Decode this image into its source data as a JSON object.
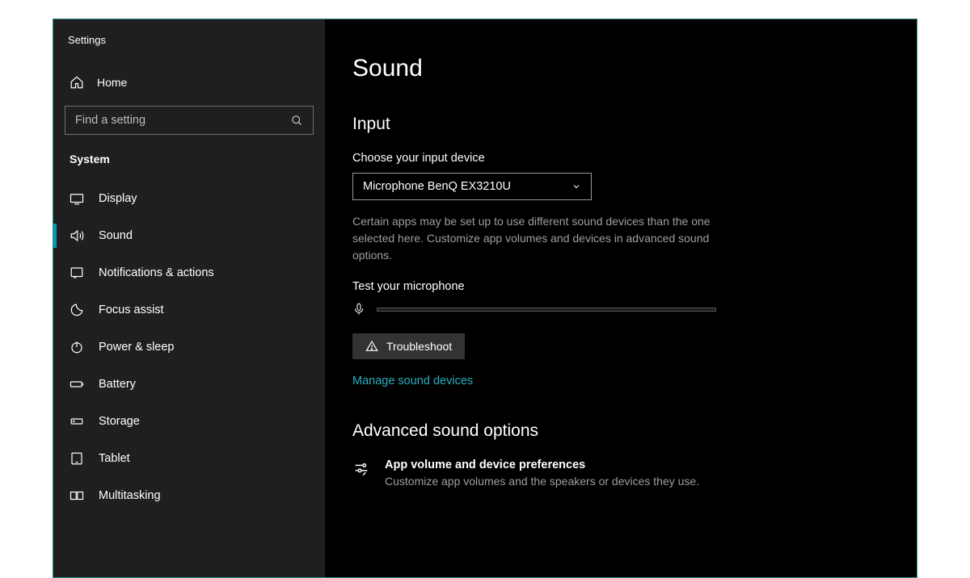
{
  "app": {
    "title": "Settings"
  },
  "sidebar": {
    "home": "Home",
    "search_placeholder": "Find a setting",
    "section": "System",
    "items": [
      {
        "label": "Display"
      },
      {
        "label": "Sound"
      },
      {
        "label": "Notifications & actions"
      },
      {
        "label": "Focus assist"
      },
      {
        "label": "Power & sleep"
      },
      {
        "label": "Battery"
      },
      {
        "label": "Storage"
      },
      {
        "label": "Tablet"
      },
      {
        "label": "Multitasking"
      }
    ]
  },
  "main": {
    "title": "Sound",
    "input": {
      "heading": "Input",
      "choose_label": "Choose your input device",
      "selected": "Microphone BenQ EX3210U",
      "help": "Certain apps may be set up to use different sound devices than the one selected here. Customize app volumes and devices in advanced sound options.",
      "test_label": "Test your microphone",
      "troubleshoot": "Troubleshoot",
      "manage_link": "Manage sound devices"
    },
    "advanced": {
      "heading": "Advanced sound options",
      "pref_title": "App volume and device preferences",
      "pref_sub": "Customize app volumes and the speakers or devices they use."
    }
  }
}
